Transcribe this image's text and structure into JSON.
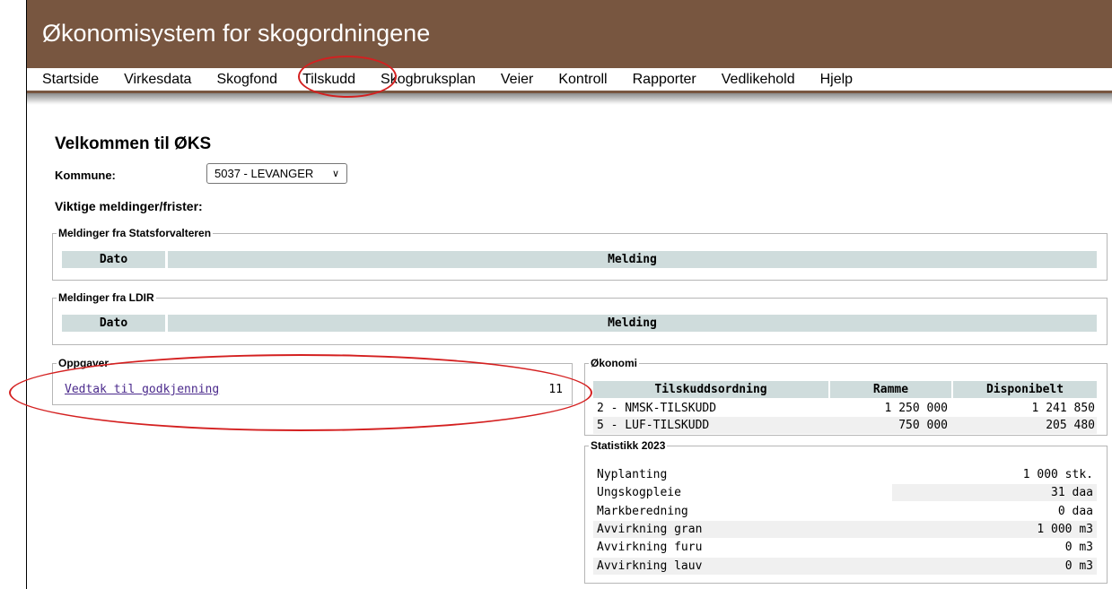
{
  "header": {
    "title": "Økonomisystem for skogordningene"
  },
  "menu": {
    "items": [
      {
        "label": "Startside"
      },
      {
        "label": "Virkesdata"
      },
      {
        "label": "Skogfond"
      },
      {
        "label": "Tilskudd"
      },
      {
        "label": "Skogbruksplan"
      },
      {
        "label": "Veier"
      },
      {
        "label": "Kontroll"
      },
      {
        "label": "Rapporter"
      },
      {
        "label": "Vedlikehold"
      },
      {
        "label": "Hjelp"
      }
    ]
  },
  "page": {
    "heading": "Velkommen til ØKS",
    "kommune_label": "Kommune:",
    "kommune_value": "5037 - LEVANGER",
    "notices_label": "Viktige meldinger/frister:"
  },
  "statsforvalteren": {
    "legend": "Meldinger fra Statsforvalteren",
    "col_date": "Dato",
    "col_message": "Melding"
  },
  "ldir": {
    "legend": "Meldinger fra LDIR",
    "col_date": "Dato",
    "col_message": "Melding"
  },
  "oppgaver": {
    "legend": "Oppgaver",
    "items": [
      {
        "label": "Vedtak til godkjenning",
        "count": "11"
      }
    ]
  },
  "okonomi": {
    "legend": "Økonomi",
    "columns": [
      "Tilskuddsordning",
      "Ramme",
      "Disponibelt"
    ],
    "rows": [
      {
        "ordning": "2 - NMSK-TILSKUDD",
        "ramme": "1 250 000",
        "disponibelt": "1 241 850"
      },
      {
        "ordning": "5 - LUF-TILSKUDD",
        "ramme": "750 000",
        "disponibelt": "205 480"
      }
    ]
  },
  "statistikk": {
    "legend": "Statistikk 2023",
    "rows": [
      {
        "label": "Nyplanting",
        "value": "1 000 stk."
      },
      {
        "label": "Ungskogpleie",
        "value": "31 daa"
      },
      {
        "label": "Markberedning",
        "value": "0 daa"
      },
      {
        "label": "Avvirkning gran",
        "value": "1 000 m3"
      },
      {
        "label": "Avvirkning furu",
        "value": "0 m3"
      },
      {
        "label": "Avvirkning lauv",
        "value": "0 m3"
      }
    ]
  },
  "colors": {
    "header_bg": "#785640",
    "grid_header_bg": "#cfdcdc",
    "annotation": "#d42020",
    "link": "#4b2a8c"
  }
}
